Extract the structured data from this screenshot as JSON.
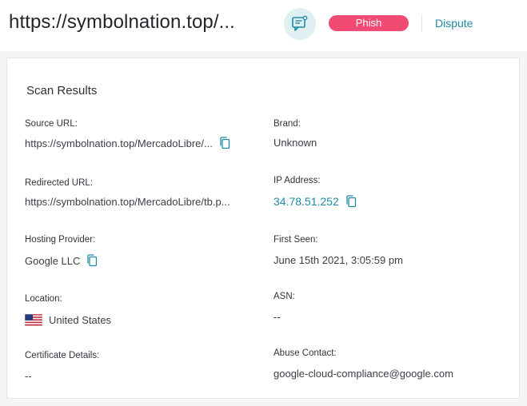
{
  "header": {
    "url_title": "https://symbolnation.top/...",
    "status_badge": "Phish",
    "dispute_label": "Dispute",
    "feedback_icon": "chat-feedback-icon",
    "badge_color": "#f24b73",
    "accent_color": "#1f8aa6"
  },
  "scan_results": {
    "title": "Scan Results",
    "fields": {
      "source_url": {
        "label": "Source URL:",
        "value": "https://symbolnation.top/MercadoLibre/..."
      },
      "brand": {
        "label": "Brand:",
        "value": "Unknown"
      },
      "redirected_url": {
        "label": "Redirected URL:",
        "value": "https://symbolnation.top/MercadoLibre/tb.p..."
      },
      "ip_address": {
        "label": "IP Address:",
        "value": "34.78.51.252"
      },
      "hosting_provider": {
        "label": "Hosting Provider:",
        "value": "Google LLC"
      },
      "first_seen": {
        "label": "First Seen:",
        "value": "June 15th 2021, 3:05:59 pm"
      },
      "location": {
        "label": "Location:",
        "value": "United States",
        "flag_icon": "us-flag-icon"
      },
      "asn": {
        "label": "ASN:",
        "value": "--"
      },
      "certificate_details": {
        "label": "Certificate Details:",
        "value": "--"
      },
      "abuse_contact": {
        "label": "Abuse Contact:",
        "value": "google-cloud-compliance@google.com"
      }
    }
  }
}
